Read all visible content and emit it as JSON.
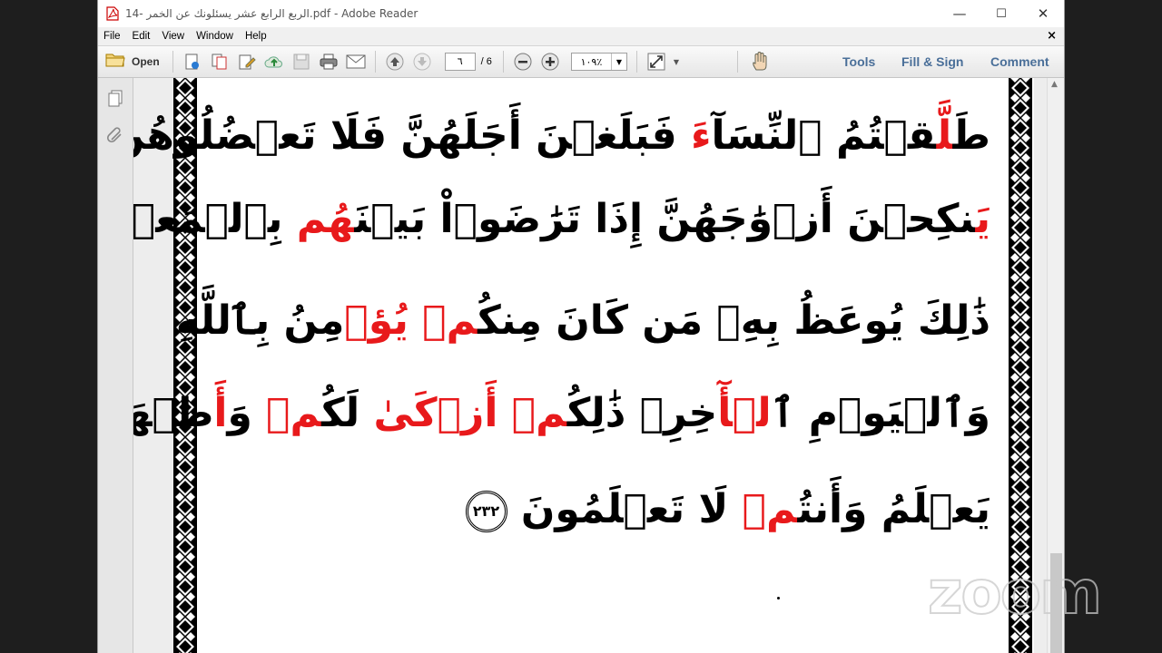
{
  "window": {
    "title": "14- الربع الرابع عشر يسئلونك عن الخمر.pdf - Adobe Reader",
    "minimize": "—",
    "maximize": "☐",
    "close": "✕"
  },
  "menu": {
    "items": [
      "File",
      "Edit",
      "View",
      "Window",
      "Help"
    ],
    "close": "×"
  },
  "toolbar": {
    "open_label": "Open",
    "page_current": "٦",
    "page_total": "/ 6",
    "zoom": "١٠٩٪",
    "tools": "Tools",
    "fill_sign": "Fill & Sign",
    "comment": "Comment"
  },
  "document": {
    "lines": [
      [
        {
          "t": "طَ",
          "red": false
        },
        {
          "t": "لَّ",
          "red": true
        },
        {
          "t": "قۡتُمُ ٱلنِّسَآ",
          "red": false
        },
        {
          "t": "ءَ",
          "red": true
        },
        {
          "t": " فَبَلَغۡنَ أَجَلَهُنَّ فَلَا تَعۡضُلُوهُنَّ أَن",
          "red": false
        }
      ],
      [
        {
          "t": "يَ",
          "red": true
        },
        {
          "t": "نكِحۡنَ أَزۡوَٰجَهُنَّ إِذَا تَرَٰضَوۡاْ بَيۡنَ",
          "red": false
        },
        {
          "t": "هُم",
          "red": true
        },
        {
          "t": " بِٱلۡمَعۡرُوفِۗ",
          "red": false
        }
      ],
      [
        {
          "t": "ذَٰلِكَ يُوعَظُ بِهِۦ مَن كَانَ مِنكُ",
          "red": false
        },
        {
          "t": "مۡ",
          "red": true
        },
        {
          "t": " ",
          "red": false
        },
        {
          "t": "يُؤۡ",
          "red": true
        },
        {
          "t": "مِنُ بِٱللَّهِ",
          "red": false
        }
      ],
      [
        {
          "t": "وَٱلۡيَوۡمِ ٱ",
          "red": false
        },
        {
          "t": "لۡأٓ",
          "red": true
        },
        {
          "t": "خِرِۗ ذَٰلِكُ",
          "red": false
        },
        {
          "t": "مۡ",
          "red": true
        },
        {
          "t": " ",
          "red": false
        },
        {
          "t": "أَزۡكَىٰ",
          "red": true
        },
        {
          "t": " لَكُ",
          "red": false
        },
        {
          "t": "مۡ",
          "red": true
        },
        {
          "t": " وَ",
          "red": false
        },
        {
          "t": "أَ",
          "red": true
        },
        {
          "t": "طۡهَرُۚ وَٱللَّهُ",
          "red": false
        }
      ],
      [
        {
          "t": "يَعۡلَمُ وَأَنتُ",
          "red": false
        },
        {
          "t": "مۡ",
          "red": true
        },
        {
          "t": " لَا تَعۡلَمُونَ",
          "red": false
        }
      ]
    ],
    "ayah_number": "٢٣٢"
  },
  "watermark": "zoom",
  "colors": {
    "red_text": "#e8191b",
    "link_blue": "#4a6f99",
    "background": "#1e1e1e"
  },
  "icons": [
    "pdf-icon",
    "folder-icon",
    "create-pdf-icon",
    "combine-icon",
    "edit-icon",
    "upload-icon",
    "save-icon",
    "print-icon",
    "email-icon",
    "previous-page-icon",
    "next-page-icon",
    "zoom-out-icon",
    "zoom-in-icon",
    "fit-page-icon",
    "hand-tool-icon",
    "pages-panel-icon",
    "attachments-icon"
  ]
}
